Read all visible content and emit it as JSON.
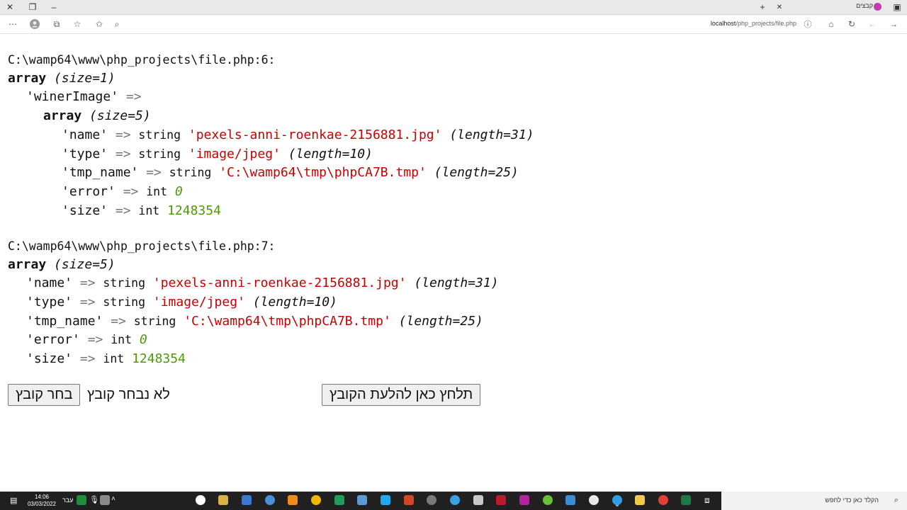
{
  "browser": {
    "tab_title": "קבצים",
    "url_host": "localhost",
    "url_path": "/php_projects/file.php"
  },
  "dump1": {
    "path": "C:\\wamp64\\www\\php_projects\\file.php:6:",
    "array_kw": "array",
    "array_size": "(size=1)",
    "key": "'winerImage'",
    "inner_kw": "array",
    "inner_size": "(size=5)",
    "rows": [
      {
        "key": "'name'",
        "type": "string",
        "value": "'pexels-anni-roenkae-2156881.jpg'",
        "meta": "(length=31)"
      },
      {
        "key": "'type'",
        "type": "string",
        "value": "'image/jpeg'",
        "meta": "(length=10)"
      },
      {
        "key": "'tmp_name'",
        "type": "string",
        "value": "'C:\\wamp64\\tmp\\phpCA7B.tmp'",
        "meta": "(length=25)"
      },
      {
        "key": "'error'",
        "type": "int",
        "value": "0",
        "meta": ""
      },
      {
        "key": "'size'",
        "type": "int",
        "value": "1248354",
        "meta": ""
      }
    ]
  },
  "dump2": {
    "path": "C:\\wamp64\\www\\php_projects\\file.php:7:",
    "array_kw": "array",
    "array_size": "(size=5)",
    "rows": [
      {
        "key": "'name'",
        "type": "string",
        "value": "'pexels-anni-roenkae-2156881.jpg'",
        "meta": "(length=31)"
      },
      {
        "key": "'type'",
        "type": "string",
        "value": "'image/jpeg'",
        "meta": "(length=10)"
      },
      {
        "key": "'tmp_name'",
        "type": "string",
        "value": "'C:\\wamp64\\tmp\\phpCA7B.tmp'",
        "meta": "(length=25)"
      },
      {
        "key": "'error'",
        "type": "int",
        "value": "0",
        "meta": ""
      },
      {
        "key": "'size'",
        "type": "int",
        "value": "1248354",
        "meta": ""
      }
    ]
  },
  "arrow": "=>",
  "form": {
    "choose_file_label": "בחר קובץ",
    "no_file_text": "לא נבחר קובץ",
    "upload_label": "תלחץ כאן להלעת הקובץ"
  },
  "taskbar": {
    "search_placeholder": "הקלד כאן כדי לחפש",
    "time": "14:06",
    "date": "03/03/2022",
    "lang": "עבר"
  },
  "colors": {
    "string_value": "#cc0000",
    "int_value": "#4e9a06",
    "taskbar": "#202020"
  }
}
